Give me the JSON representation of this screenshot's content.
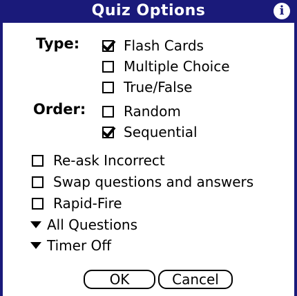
{
  "dialog": {
    "title": "Quiz Options",
    "info_icon": "info-icon",
    "accent_color": "#1a1a7a"
  },
  "type_section": {
    "label": "Type:",
    "options": [
      {
        "label": "Flash Cards",
        "checked": true
      },
      {
        "label": "Multiple Choice",
        "checked": false
      },
      {
        "label": "True/False",
        "checked": false
      }
    ]
  },
  "order_section": {
    "label": "Order:",
    "options": [
      {
        "label": "Random",
        "checked": false
      },
      {
        "label": "Sequential",
        "checked": true
      }
    ]
  },
  "toggles": [
    {
      "label": "Re-ask Incorrect",
      "checked": false
    },
    {
      "label": "Swap questions and answers",
      "checked": false
    },
    {
      "label": "Rapid-Fire",
      "checked": false
    }
  ],
  "popups": [
    {
      "label": "All Questions"
    },
    {
      "label": "Timer Off"
    }
  ],
  "buttons": {
    "ok": "OK",
    "cancel": "Cancel"
  }
}
